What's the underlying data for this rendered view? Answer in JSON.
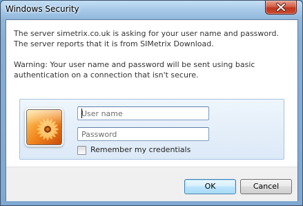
{
  "window": {
    "title": "Windows Security",
    "close_icon": "close-icon"
  },
  "message": {
    "line1": "The server simetrix.co.uk is asking for your user name and password. The server reports that it is from SIMetrix Download.",
    "warning": "Warning: Your user name and password will be sent using basic authentication on a connection that isn't secure."
  },
  "credentials": {
    "user_tile_icon": "flower-user-tile-icon",
    "username_value": "",
    "username_placeholder": "User name",
    "password_value": "",
    "password_placeholder": "Password",
    "remember_label": "Remember my credentials",
    "remember_checked": false
  },
  "buttons": {
    "ok_label": "OK",
    "cancel_label": "Cancel"
  },
  "colors": {
    "accent": "#3c7fb1",
    "panel_background": "#dce9f7",
    "close_button": "#c84a2e"
  }
}
